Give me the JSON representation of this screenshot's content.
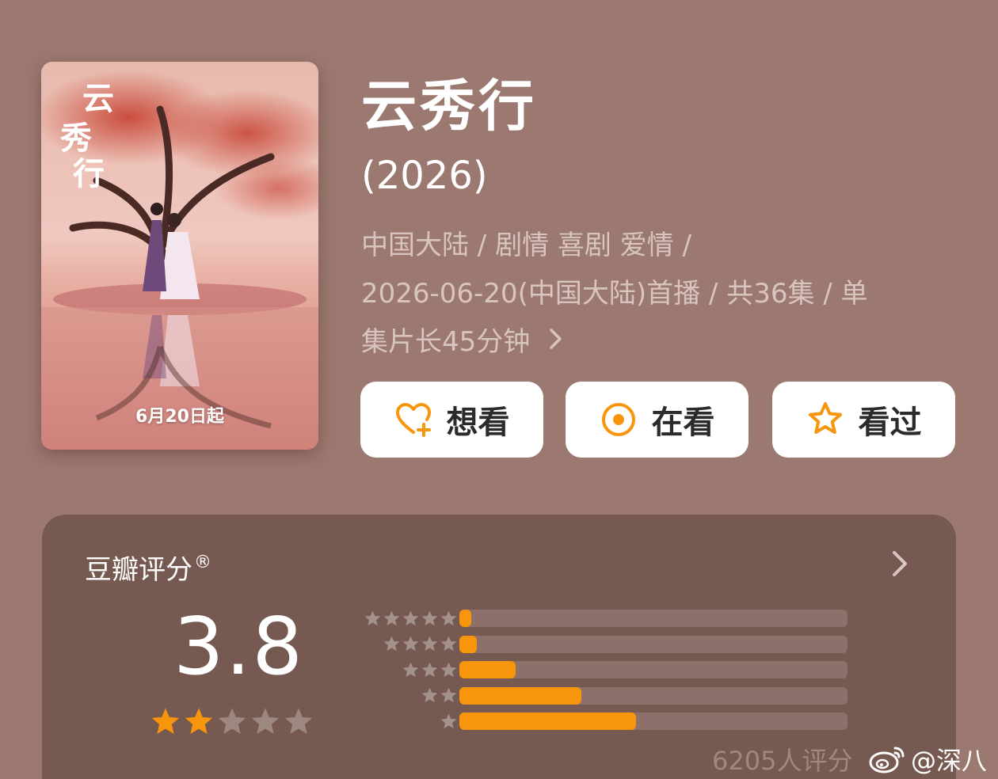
{
  "poster": {
    "calligraphy_title": "云秀行",
    "date_text": "6月20日起"
  },
  "show": {
    "title": "云秀行",
    "year": "(2026)",
    "meta_line1": "中国大陆 / 剧情 喜剧 爱情 /",
    "meta_line2": "2026-06-20(中国大陆)首播 / 共36集 / 单",
    "meta_line3": "集片长45分钟"
  },
  "actions": {
    "want": "想看",
    "watching": "在看",
    "watched": "看过"
  },
  "rating": {
    "label": "豆瓣评分",
    "reg_mark": "®",
    "score": "3.8",
    "score_stars": 2,
    "votes": "6205人评分",
    "distribution": [
      {
        "stars": 5,
        "fraction": 0.03
      },
      {
        "stars": 4,
        "fraction": 0.045
      },
      {
        "stars": 3,
        "fraction": 0.145
      },
      {
        "stars": 2,
        "fraction": 0.315
      },
      {
        "stars": 1,
        "fraction": 0.455
      }
    ]
  },
  "colors": {
    "background": "#9c7970",
    "card": "#765951",
    "accent": "#f7960c",
    "track": "#8c7069"
  },
  "watermark": {
    "text": "@深八",
    "icon": "weibo-icon"
  }
}
